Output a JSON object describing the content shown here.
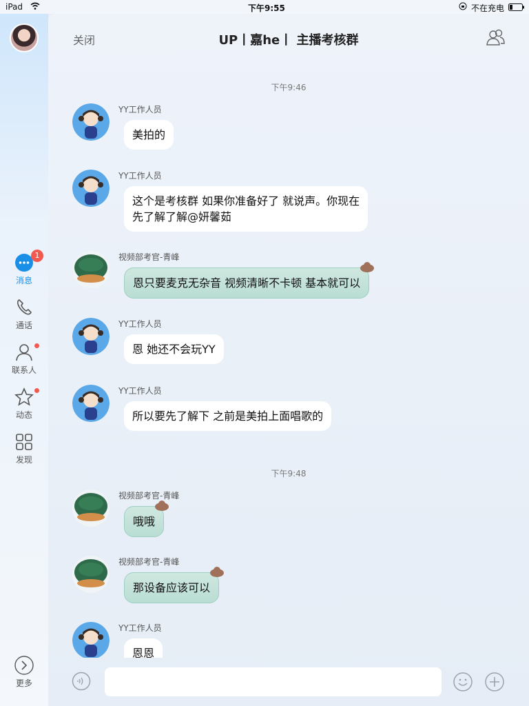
{
  "status_bar": {
    "device": "iPad",
    "time": "下午9:55",
    "battery_text": "不在充电"
  },
  "sidebar": {
    "items": [
      {
        "label": "消息",
        "icon": "chat-bubble-icon",
        "badge": "1",
        "active": true
      },
      {
        "label": "通话",
        "icon": "phone-icon"
      },
      {
        "label": "联系人",
        "icon": "contact-icon",
        "dot": true
      },
      {
        "label": "动态",
        "icon": "star-icon",
        "dot": true
      },
      {
        "label": "发现",
        "icon": "grid-icon"
      }
    ],
    "more_label": "更多"
  },
  "header": {
    "close_label": "关闭",
    "title": "UP丨嘉he丨 主播考核群",
    "people_icon": "people-icon"
  },
  "timestamps": [
    "下午9:46",
    "下午9:48"
  ],
  "messages": [
    {
      "sender": "YY工作人员",
      "text": "美拍的",
      "style": "white"
    },
    {
      "sender": "YY工作人员",
      "text": "这个是考核群 如果你准备好了 就说声。你现在",
      "text2": "先了解了解@妍馨茹",
      "style": "white"
    },
    {
      "sender": "视频部考官-青峰",
      "text": "恩只要麦克无杂音 视频清晰不卡顿 基本就可以",
      "style": "green"
    },
    {
      "sender": "YY工作人员",
      "text": "恩 她还不会玩YY",
      "style": "white"
    },
    {
      "sender": "YY工作人员",
      "text": "所以要先了解下 之前是美拍上面唱歌的",
      "style": "white"
    },
    {
      "sender": "视频部考官-青峰",
      "text": "哦哦",
      "style": "green"
    },
    {
      "sender": "视频部考官-青峰",
      "text": "那设备应该可以",
      "style": "green"
    },
    {
      "sender": "YY工作人员",
      "text": "恩恩",
      "style": "white"
    }
  ],
  "input": {
    "placeholder": ""
  },
  "colors": {
    "accent": "#1a8fe8",
    "badge": "#f05a4f",
    "green_bubble": "#c6e3db"
  }
}
